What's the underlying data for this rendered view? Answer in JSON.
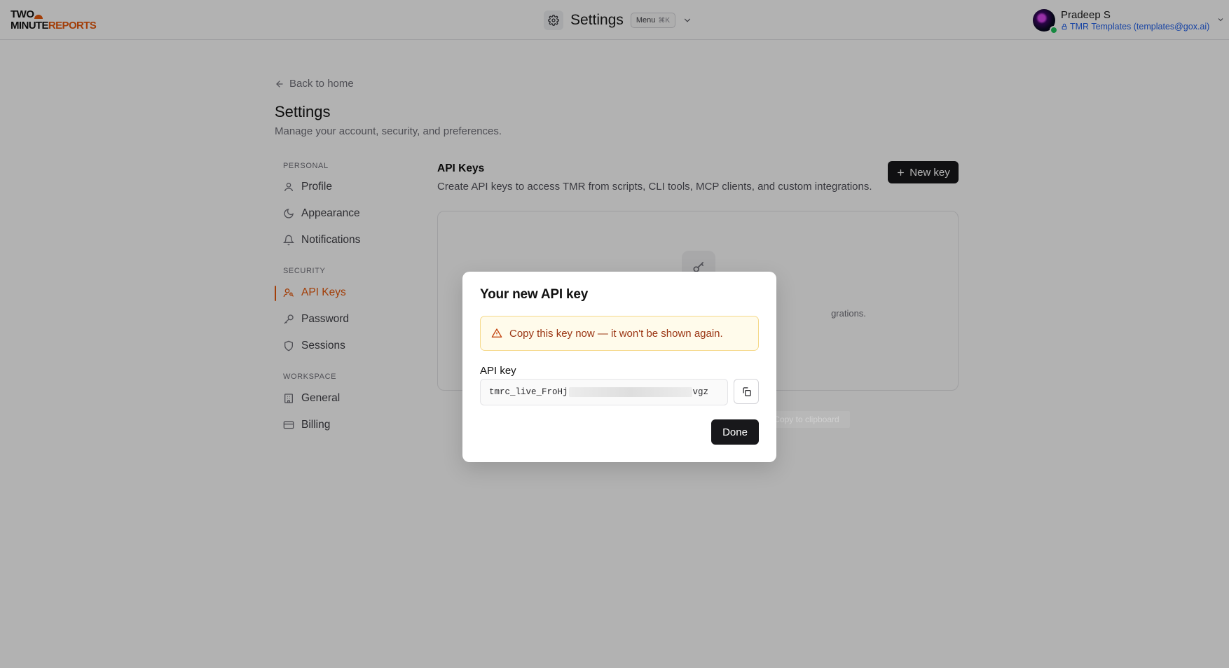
{
  "app": {
    "logo_line1": "TWO",
    "logo_line2_a": "MINUTE",
    "logo_line2_b": "REPORTS",
    "page_title": "Settings",
    "menu_label": "Menu",
    "menu_shortcut": "⌘K"
  },
  "user": {
    "name": "Pradeep S",
    "workspace": "TMR Templates (templates@gox.ai)"
  },
  "page": {
    "back_label": "Back to home",
    "title": "Settings",
    "subtitle": "Manage your account, security, and preferences."
  },
  "sidebar": {
    "sections": [
      {
        "label": "PERSONAL",
        "items": [
          {
            "label": "Profile",
            "icon": "user-icon"
          },
          {
            "label": "Appearance",
            "icon": "moon-icon"
          },
          {
            "label": "Notifications",
            "icon": "bell-icon"
          }
        ]
      },
      {
        "label": "SECURITY",
        "items": [
          {
            "label": "API Keys",
            "icon": "users-key-icon",
            "active": true
          },
          {
            "label": "Password",
            "icon": "key-icon"
          },
          {
            "label": "Sessions",
            "icon": "shield-icon"
          }
        ]
      },
      {
        "label": "WORKSPACE",
        "items": [
          {
            "label": "General",
            "icon": "building-icon"
          },
          {
            "label": "Billing",
            "icon": "credit-card-icon"
          }
        ]
      }
    ]
  },
  "api_keys": {
    "title": "API Keys",
    "description": "Create API keys to access TMR from scripts, CLI tools, MCP clients, and custom integrations.",
    "new_key_label": "New key",
    "empty_text_visible": "grations."
  },
  "tooltip": "Copy to clipboard",
  "modal": {
    "title": "Your new API key",
    "warning": "Copy this key now — it won't be shown again.",
    "field_label": "API key",
    "key_prefix": "tmrc_live_FroHj",
    "key_suffix": "vgz",
    "done_label": "Done"
  },
  "colors": {
    "accent": "#e8590c",
    "primary_button": "#18181b",
    "warning_bg": "#fffbeb",
    "warning_text": "#9a3412",
    "link": "#2563eb"
  }
}
